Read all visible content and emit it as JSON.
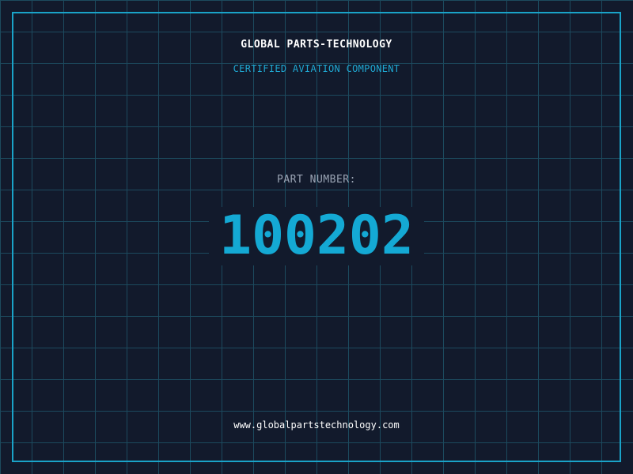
{
  "header": {
    "brand": "GLOBAL PARTS-TECHNOLOGY",
    "subtitle": "CERTIFIED AVIATION COMPONENT"
  },
  "part": {
    "label": "PART NUMBER:",
    "number": "100202"
  },
  "footer": {
    "url": "www.globalpartstechnology.com"
  },
  "colors": {
    "background": "#121a2c",
    "grid": "#1c4a5e",
    "accent": "#1aa3c8",
    "text": "#ffffff",
    "muted": "#9aa4b4"
  }
}
